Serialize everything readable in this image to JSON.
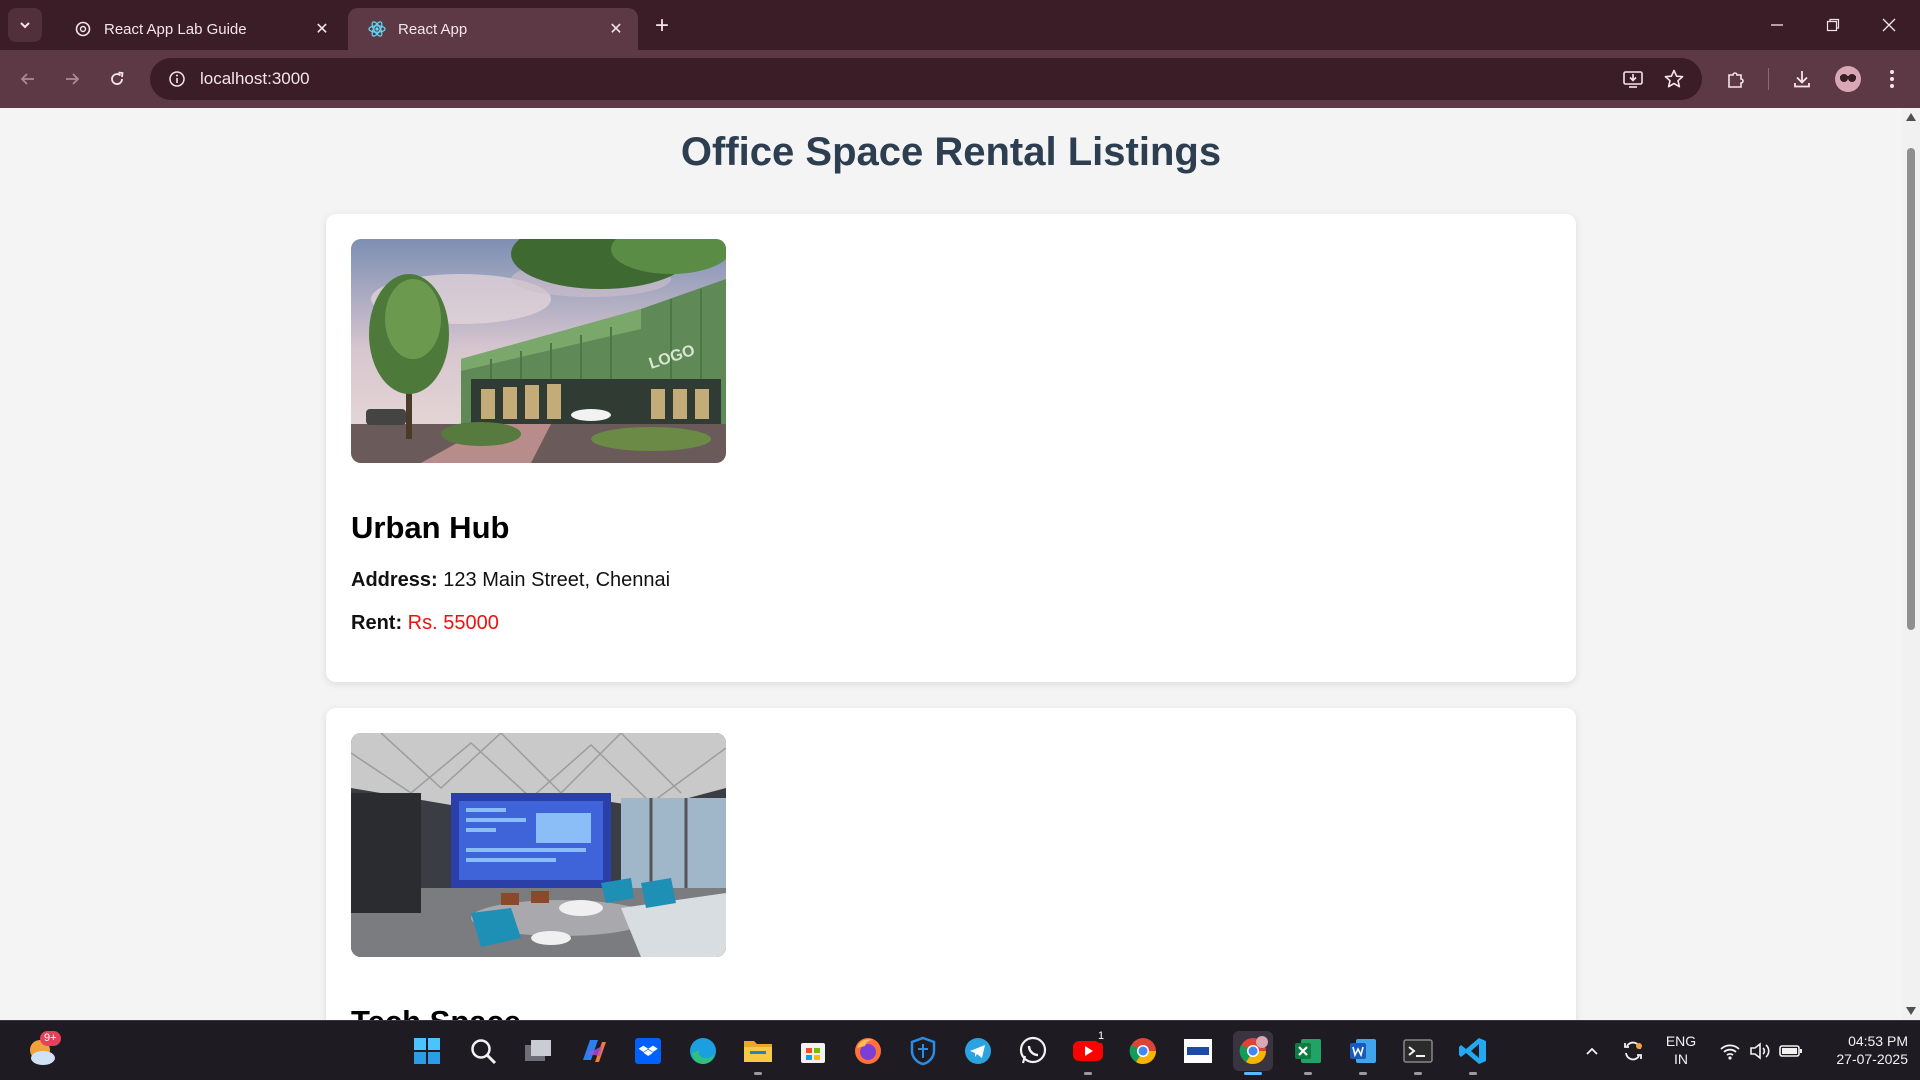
{
  "browser": {
    "tabs": [
      {
        "title": "React App Lab Guide",
        "active": false,
        "icon": "openai-icon"
      },
      {
        "title": "React App",
        "active": true,
        "icon": "react-icon"
      }
    ],
    "url": "localhost:3000"
  },
  "page": {
    "title": "Office Space Rental Listings",
    "listings": [
      {
        "name": "Urban Hub",
        "address_label": "Address:",
        "address": "123 Main Street, Chennai",
        "rent_label": "Rent:",
        "rent": "Rs. 55000",
        "image": "office-exterior-image"
      },
      {
        "name": "Tech Space",
        "image": "office-interior-image"
      }
    ]
  },
  "taskbar": {
    "weather_badge": "9+",
    "apps": [
      "windows-start",
      "search",
      "task-view",
      "copilot",
      "dropbox",
      "edge",
      "file-explorer",
      "microsoft-store",
      "firefox",
      "defender",
      "telegram",
      "whatsapp",
      "youtube",
      "chrome",
      "unstop",
      "chrome-profile",
      "excel",
      "word",
      "terminal",
      "vscode"
    ],
    "youtube_badge": "1",
    "language": "ENG",
    "region": "IN",
    "time": "04:53 PM",
    "date": "27-07-2025"
  },
  "colors": {
    "title": "#2c3e50",
    "rent": "#e11111",
    "chrome_dark": "#3a1d26",
    "chrome_light": "#5c3944"
  }
}
